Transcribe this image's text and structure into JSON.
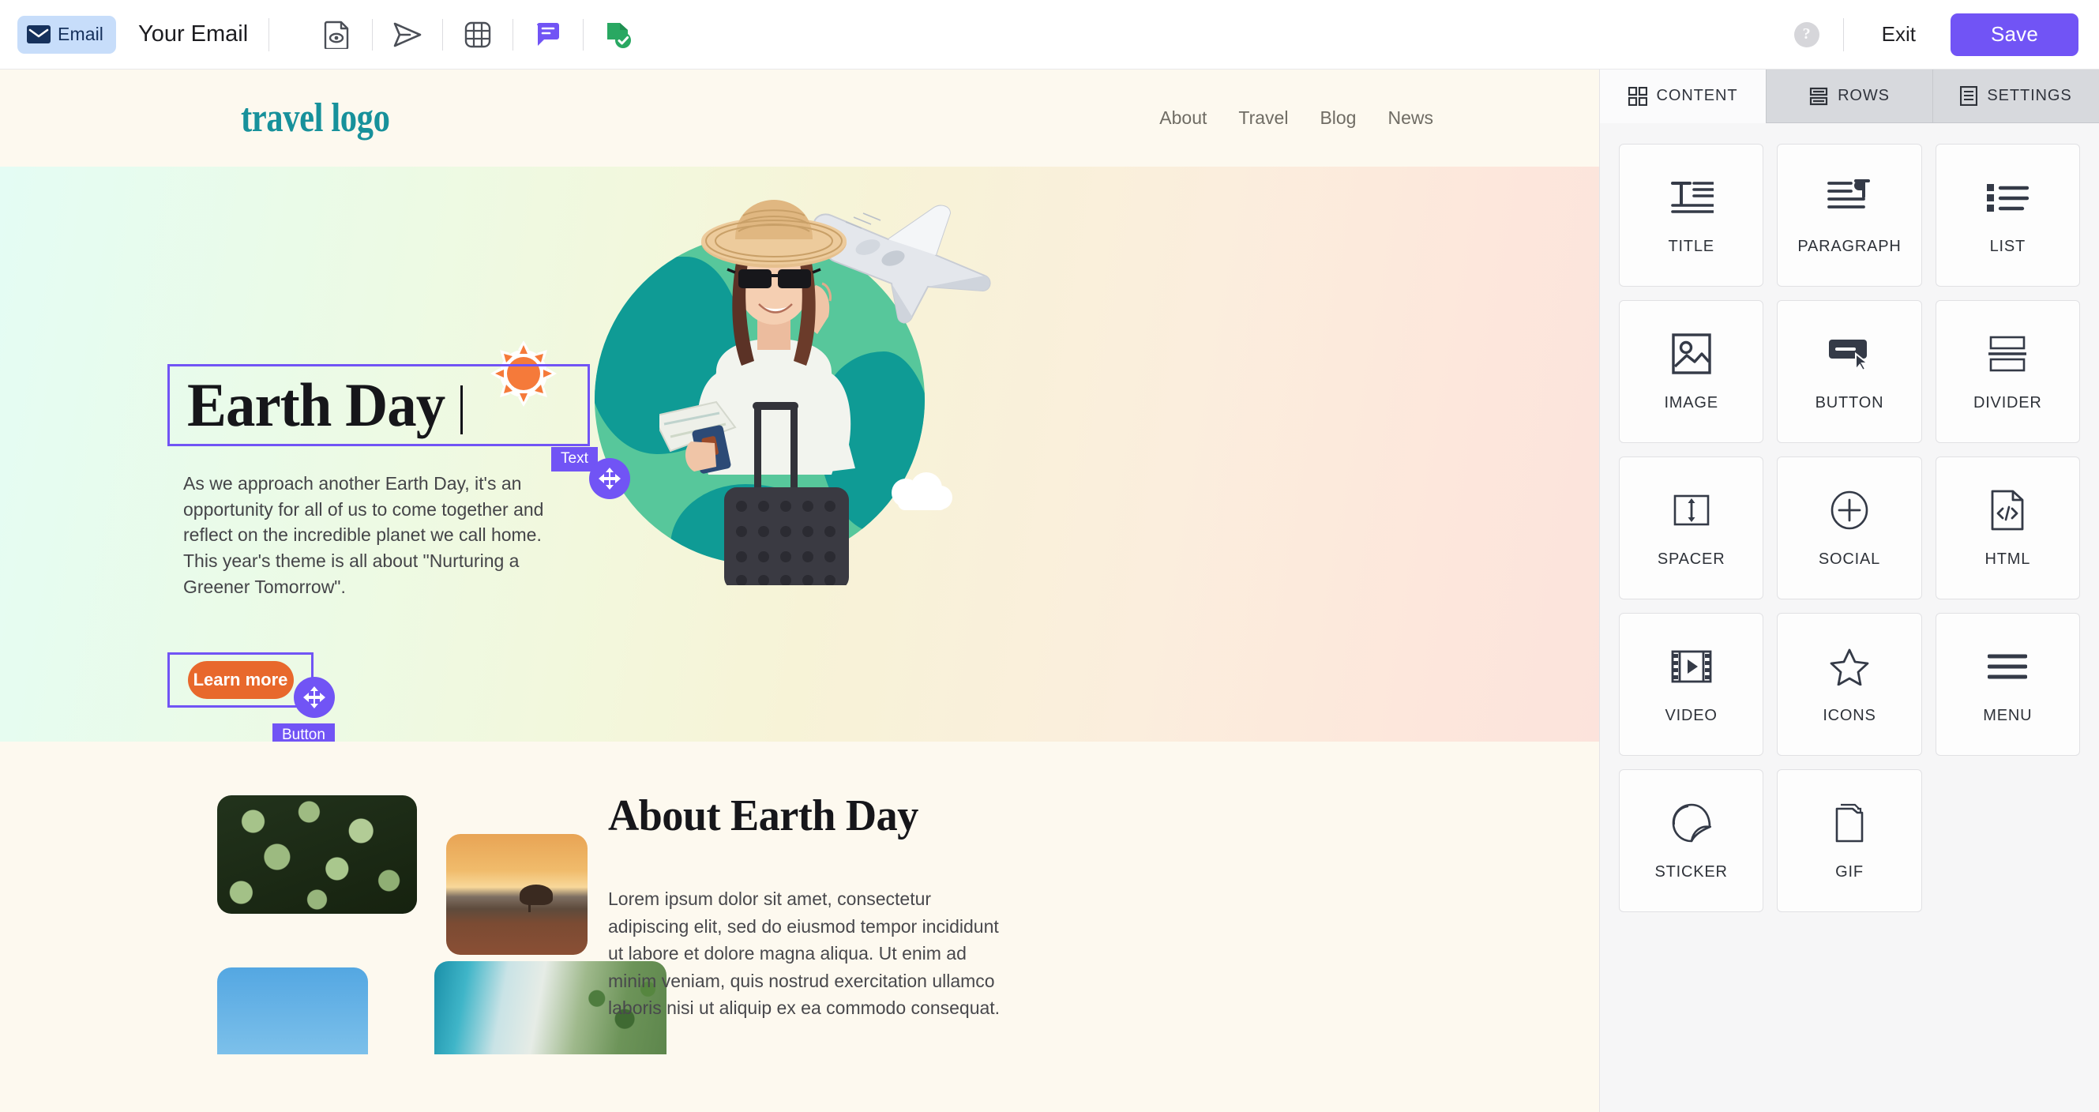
{
  "topbar": {
    "email_badge": {
      "icon": "envelope-icon",
      "label": "Email"
    },
    "doc_title": "Your Email",
    "tools": [
      {
        "name": "preview-icon",
        "label": "Preview"
      },
      {
        "name": "send-test-icon",
        "label": "Send test"
      },
      {
        "name": "grid-icon",
        "label": "Grid"
      },
      {
        "name": "comments-icon",
        "label": "Comments"
      },
      {
        "name": "spellcheck-icon",
        "label": "Check"
      }
    ],
    "help_label": "?",
    "exit_label": "Exit",
    "save_label": "Save",
    "save_color": "#7154f5"
  },
  "email": {
    "logo": "travel logo",
    "logo_color": "#17919b",
    "nav": [
      {
        "label": "About"
      },
      {
        "label": "Travel"
      },
      {
        "label": "Blog"
      },
      {
        "label": "News"
      }
    ],
    "hero": {
      "title": "Earth Day",
      "paragraph": "As we approach another Earth Day, it's an opportunity for all of us to come together and reflect on the incredible planet we call home. This year's theme is all about \"Nurturing a Greener Tomorrow\".",
      "button_label": "Learn more",
      "button_color": "#e8682c",
      "selected_text_tag": "Text",
      "selected_button_tag": "Button",
      "selection_color": "#7154f5"
    },
    "about": {
      "heading": "About Earth Day",
      "paragraph": "Lorem ipsum dolor sit amet, consectetur adipiscing elit, sed do eiusmod tempor incididunt ut labore et dolore magna aliqua. Ut enim ad minim veniam, quis nostrud exercitation ullamco laboris nisi ut aliquip ex ea commodo consequat."
    }
  },
  "panel": {
    "tabs": [
      {
        "label": "CONTENT",
        "icon": "grid-blocks-icon",
        "active": true
      },
      {
        "label": "ROWS",
        "icon": "rows-icon",
        "active": false
      },
      {
        "label": "SETTINGS",
        "icon": "settings-doc-icon",
        "active": false
      }
    ],
    "blocks": [
      {
        "label": "TITLE",
        "icon": "title-icon"
      },
      {
        "label": "PARAGRAPH",
        "icon": "paragraph-icon"
      },
      {
        "label": "LIST",
        "icon": "list-icon"
      },
      {
        "label": "IMAGE",
        "icon": "image-icon"
      },
      {
        "label": "BUTTON",
        "icon": "button-icon"
      },
      {
        "label": "DIVIDER",
        "icon": "divider-icon"
      },
      {
        "label": "SPACER",
        "icon": "spacer-icon"
      },
      {
        "label": "SOCIAL",
        "icon": "social-plus-icon"
      },
      {
        "label": "HTML",
        "icon": "html-code-icon"
      },
      {
        "label": "VIDEO",
        "icon": "video-icon"
      },
      {
        "label": "ICONS",
        "icon": "star-icon"
      },
      {
        "label": "MENU",
        "icon": "menu-hamburger-icon"
      },
      {
        "label": "STICKER",
        "icon": "sticker-icon"
      },
      {
        "label": "GIF",
        "icon": "gif-icon"
      }
    ]
  }
}
